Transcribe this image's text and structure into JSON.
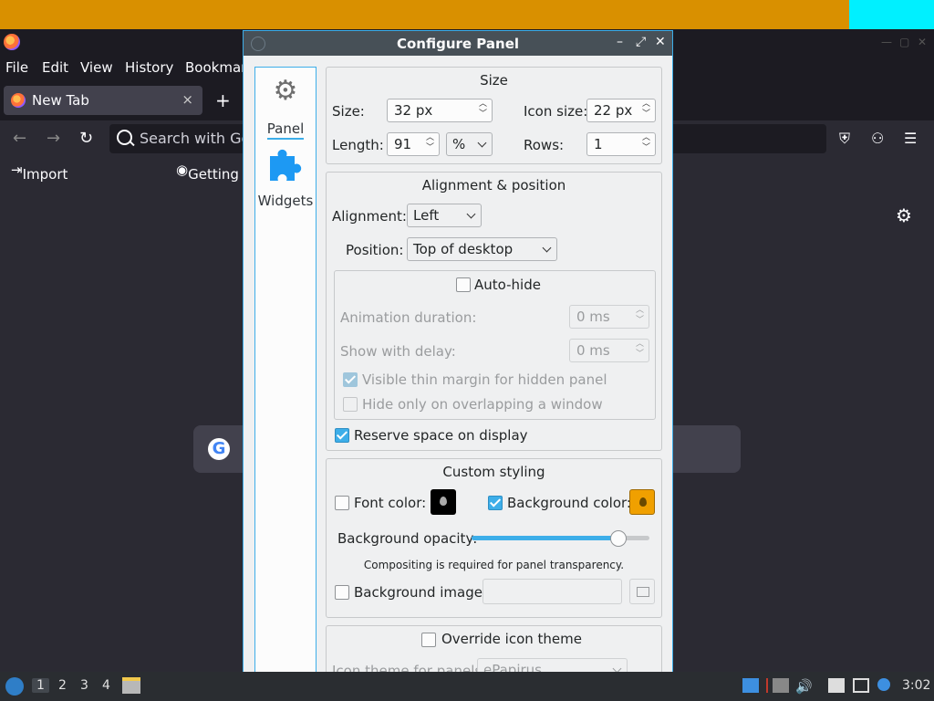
{
  "firefox": {
    "menu": [
      "File",
      "Edit",
      "View",
      "History",
      "Bookmarks"
    ],
    "tab_label": "New Tab",
    "tab_close": "×",
    "new_tab": "+",
    "search_placeholder": "Search with Google or enter address",
    "bookmarks": [
      "Import bookmarks...",
      "Getting Started"
    ]
  },
  "dialog": {
    "title": "Configure Panel",
    "controls": [
      "–",
      "⤢",
      "✕"
    ],
    "sidebar": {
      "panel": "Panel",
      "widgets": "Widgets"
    },
    "size": {
      "title": "Size",
      "size_label": "Size:",
      "size_value": "32 px",
      "icon_size_label": "Icon size:",
      "icon_size_value": "22 px",
      "length_label": "Length:",
      "length_value": "91",
      "length_unit": "%",
      "rows_label": "Rows:",
      "rows_value": "1"
    },
    "alignment": {
      "title": "Alignment & position",
      "alignment_label": "Alignment:",
      "alignment_value": "Left",
      "position_label": "Position:",
      "position_value": "Top of desktop",
      "autohide_label": "Auto-hide",
      "autohide_checked": false,
      "anim_label": "Animation duration:",
      "anim_value": "0 ms",
      "delay_label": "Show with delay:",
      "delay_value": "0 ms",
      "thin_margin_label": "Visible thin margin for hidden panel",
      "thin_margin_checked": true,
      "overlap_label": "Hide only on overlapping a window",
      "overlap_checked": false,
      "reserve_label": "Reserve space on display",
      "reserve_checked": true
    },
    "styling": {
      "title": "Custom styling",
      "font_color_label": "Font color:",
      "font_color_checked": false,
      "font_color": "#000000",
      "bg_color_label": "Background color:",
      "bg_color_checked": true,
      "bg_color": "#f0a000",
      "opacity_label": "Background opacity:",
      "opacity_fraction": 0.82,
      "compositing_note": "Compositing is required for panel transparency.",
      "bg_image_label": "Background image:",
      "bg_image_checked": false
    },
    "icon_theme": {
      "override_label": "Override icon theme",
      "override_checked": false,
      "theme_label": "Icon theme for panels:",
      "theme_value": "ePapirus"
    }
  },
  "taskbar": {
    "workspaces": [
      "1",
      "2",
      "3",
      "4"
    ],
    "active_workspace": "1",
    "clock": "3:02"
  },
  "colors": {
    "top_panel": "#d99000",
    "accent": "#3daee9",
    "titlebar": "#475057"
  }
}
